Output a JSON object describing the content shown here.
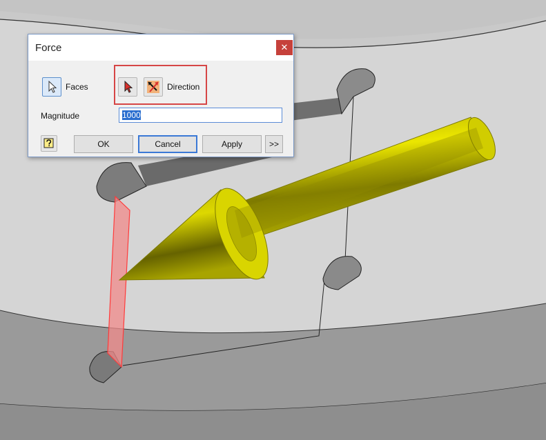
{
  "dialog": {
    "title": "Force",
    "close_glyph": "✕",
    "faces_label": "Faces",
    "direction_label": "Direction",
    "magnitude_label": "Magnitude",
    "magnitude_value": "1000",
    "ok_label": "OK",
    "cancel_label": "Cancel",
    "apply_label": "Apply",
    "more_label": ">>"
  },
  "icons": {
    "faces_select": "select-arrow-icon",
    "direction_select": "red-select-arrow-icon",
    "flip_direction": "flip-direction-icon",
    "help": "help-icon"
  },
  "colors": {
    "accent": "#3a78d6",
    "highlight": "#d64545",
    "force_arrow": "#c9c400",
    "selected_face": "#f08a8a",
    "close_button": "#c6413b"
  }
}
